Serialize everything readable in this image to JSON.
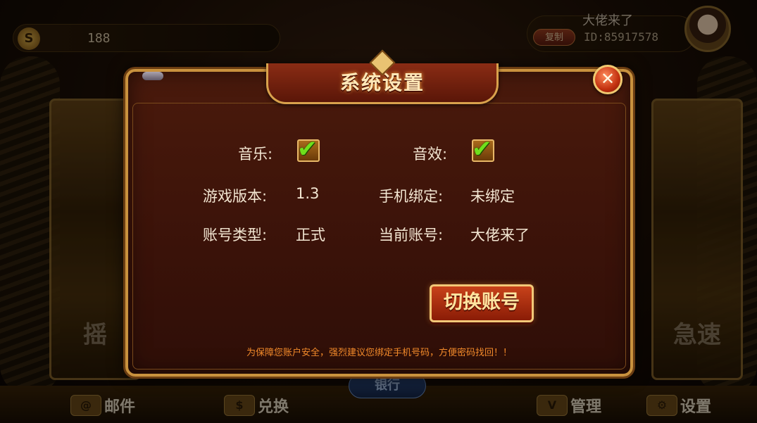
{
  "background": {
    "coins": "188",
    "coin_icon_glyph": "S",
    "user_name": "大佬来了",
    "copy_label": "复制",
    "user_id": "ID:85917578",
    "left_card_label": "摇",
    "right_card_label": "急速",
    "bank_label": "银行",
    "bottom_nav": [
      {
        "label": "邮件",
        "icon": "mail-icon"
      },
      {
        "label": "兑换",
        "icon": "exchange-icon"
      },
      {
        "label": "管理",
        "icon": "svip-icon"
      },
      {
        "label": "设置",
        "icon": "gear-icon"
      }
    ]
  },
  "dialog": {
    "title": "系统设置",
    "close_glyph": "✕",
    "music_label": "音乐:",
    "music_checked": true,
    "sfx_label": "音效:",
    "sfx_checked": true,
    "check_glyph": "✔",
    "version_label": "游戏版本:",
    "version_value": "1.3",
    "phone_bind_label": "手机绑定:",
    "phone_bind_value": "未绑定",
    "account_type_label": "账号类型:",
    "account_type_value": "正式",
    "current_account_label": "当前账号:",
    "current_account_value": "大佬来了",
    "switch_account_label": "切换账号",
    "warning_text": "为保障您账户安全，强烈建议您绑定手机号码，方便密码找回！！"
  },
  "colors": {
    "accent_gold": "#c9923e",
    "warning_orange": "#f28a2a",
    "check_green": "#6fe01c"
  }
}
